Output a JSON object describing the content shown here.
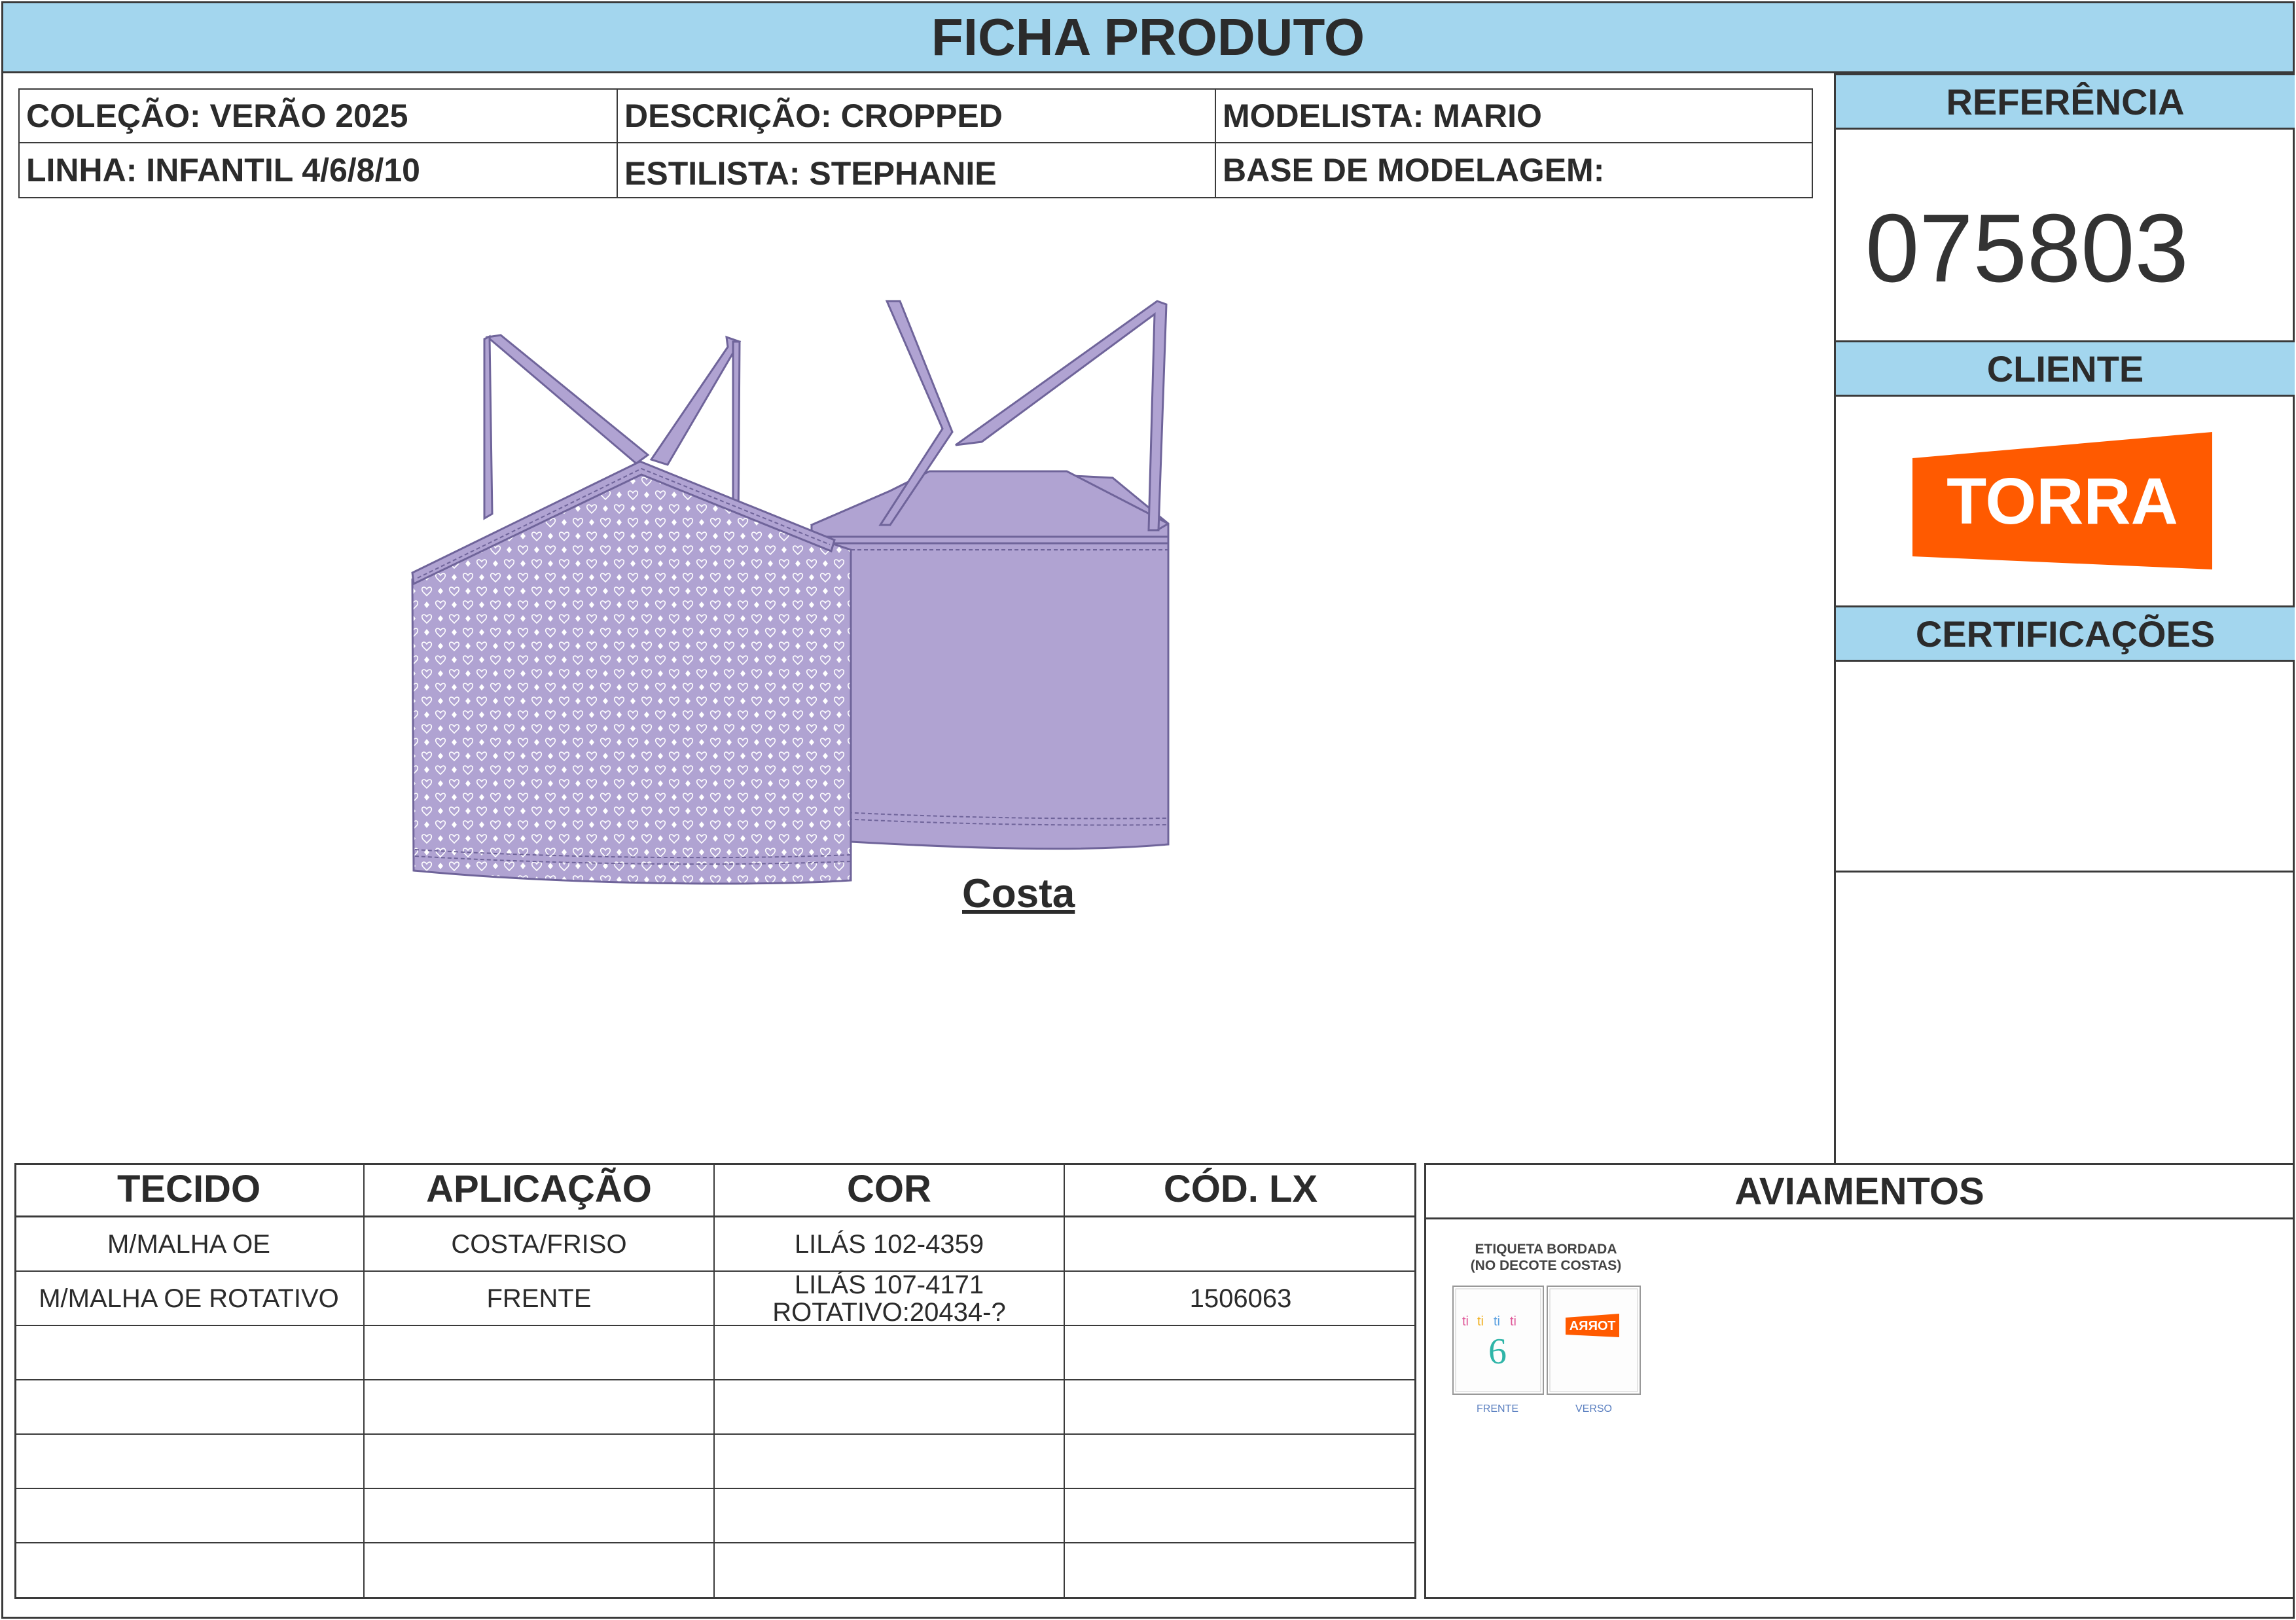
{
  "header": {
    "title": "FICHA PRODUTO"
  },
  "info": {
    "colecao": "COLEÇÃO: VERÃO 2025",
    "descricao": "DESCRIÇÃO: CROPPED",
    "modelista": "MODELISTA: MARIO",
    "linha": "LINHA: INFANTIL 4/6/8/10",
    "estilista": "ESTILISTA: STEPHANIE",
    "base": "BASE DE MODELAGEM:"
  },
  "side": {
    "referencia_label": "REFERÊNCIA",
    "referencia_value": "075803",
    "cliente_label": "CLIENTE",
    "cliente_logo_text": "TORRA",
    "certificacoes_label": "CERTIFICAÇÕES"
  },
  "drawing": {
    "back_label": "Costa"
  },
  "colors": {
    "accent": "#a3d6ee",
    "lilac": "#b0a3d2",
    "lilac_dark": "#8f7fbd",
    "torra": "#ff5a00"
  },
  "materials": {
    "headers": [
      "TECIDO",
      "APLICAÇÃO",
      "COR",
      "CÓD. LX"
    ],
    "rows": [
      [
        "M/MALHA OE",
        "COSTA/FRISO",
        "LILÁS 102-4359",
        ""
      ],
      [
        "M/MALHA OE ROTATIVO",
        "FRENTE",
        "LILÁS 107-4171\nROTATIVO:20434-?",
        "1506063"
      ],
      [
        "",
        "",
        "",
        ""
      ],
      [
        "",
        "",
        "",
        ""
      ],
      [
        "",
        "",
        "",
        ""
      ],
      [
        "",
        "",
        "",
        ""
      ],
      [
        "",
        "",
        "",
        ""
      ]
    ]
  },
  "aviamentos": {
    "title": "AVIAMENTOS",
    "label_title_1": "ETIQUETA BORDADA",
    "label_title_2": "(NO DECOTE COSTAS)",
    "label_size": "6",
    "label_front": "FRENTE",
    "label_back": "VERSO",
    "label_logo": "TORRA"
  }
}
